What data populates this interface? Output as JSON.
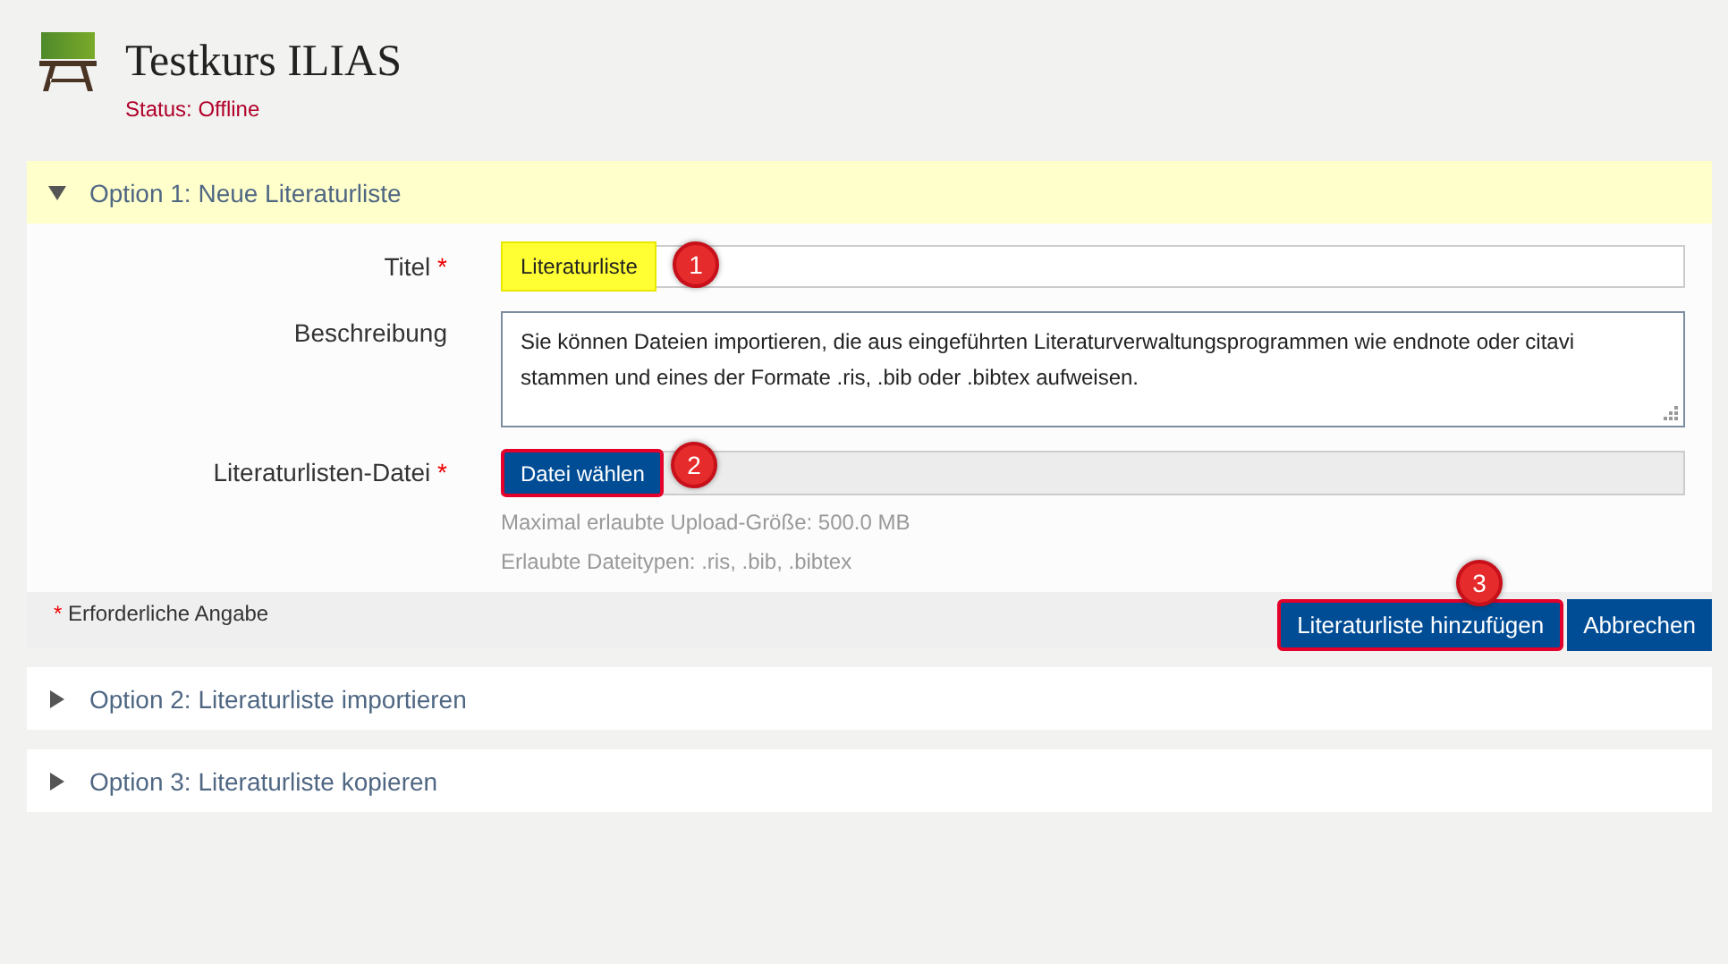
{
  "header": {
    "title": "Testkurs ILIAS",
    "status": "Status: Offline"
  },
  "required_marker": "*",
  "sections": [
    {
      "title": "Option 1: Neue Literaturliste",
      "expanded": true,
      "fields": [
        {
          "kind": "text",
          "label": "Titel",
          "required": true,
          "value": "Literaturliste",
          "highlighted": true,
          "callout": "1"
        },
        {
          "kind": "textarea",
          "label": "Beschreibung",
          "required": false,
          "value": "Sie können Dateien importieren, die aus eingeführten Literaturverwaltungsprogrammen wie endnote oder citavi stammen und eines der Formate .ris, .bib oder .bibtex aufweisen."
        },
        {
          "kind": "file",
          "label": "Literaturlisten-Datei",
          "required": true,
          "button": "Datei wählen",
          "highlighted": true,
          "callout": "2",
          "hints": [
            "Maximal erlaubte Upload-Größe: 500.0 MB",
            "Erlaubte Dateitypen: .ris, .bib, .bibtex"
          ]
        }
      ],
      "footer": {
        "note": "Erforderliche Angabe",
        "buttons": [
          {
            "label": "Literaturliste hinzufügen",
            "highlighted": true,
            "callout": "3"
          },
          {
            "label": "Abbrechen",
            "highlighted": false
          }
        ]
      }
    },
    {
      "title": "Option 2: Literaturliste importieren",
      "expanded": false
    },
    {
      "title": "Option 3: Literaturliste kopieren",
      "expanded": false
    }
  ]
}
